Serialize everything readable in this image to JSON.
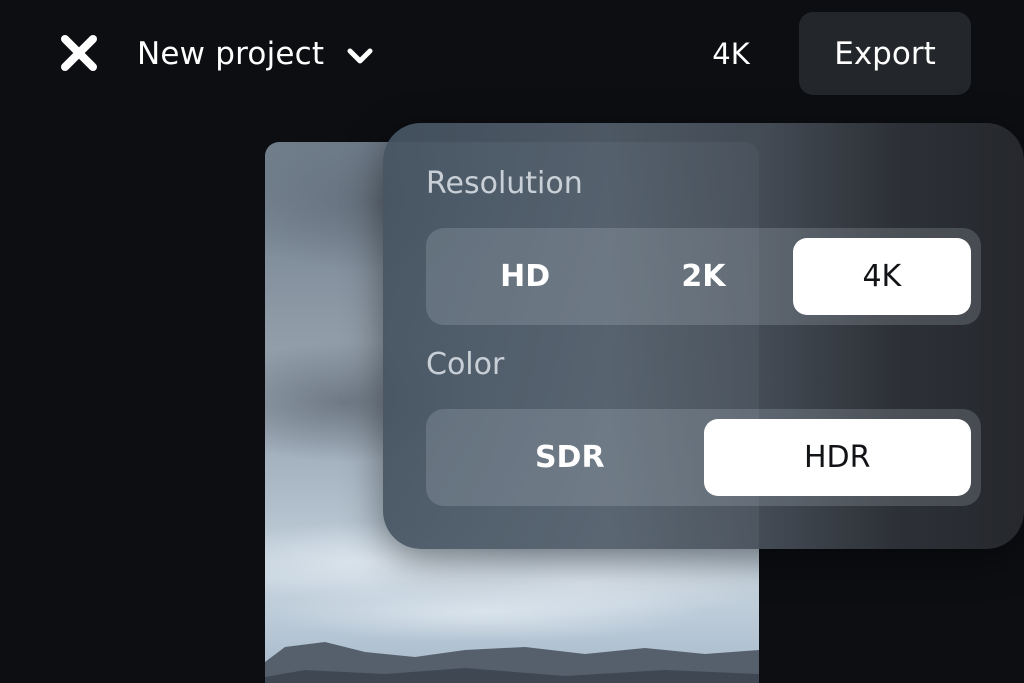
{
  "header": {
    "project_title": "New project",
    "resolution_indicator": "4K",
    "export_label": "Export"
  },
  "settings": {
    "resolution": {
      "label": "Resolution",
      "options": [
        "HD",
        "2K",
        "4K"
      ],
      "selected": "4K"
    },
    "color": {
      "label": "Color",
      "options": [
        "SDR",
        "HDR"
      ],
      "selected": "HDR"
    }
  },
  "icons": {
    "close": "close-icon",
    "chevron": "chevron-down-icon"
  },
  "colors": {
    "background": "#0c0e12",
    "export_button": "#23262b",
    "selected_segment": "#ffffff",
    "text": "#ffffff"
  }
}
